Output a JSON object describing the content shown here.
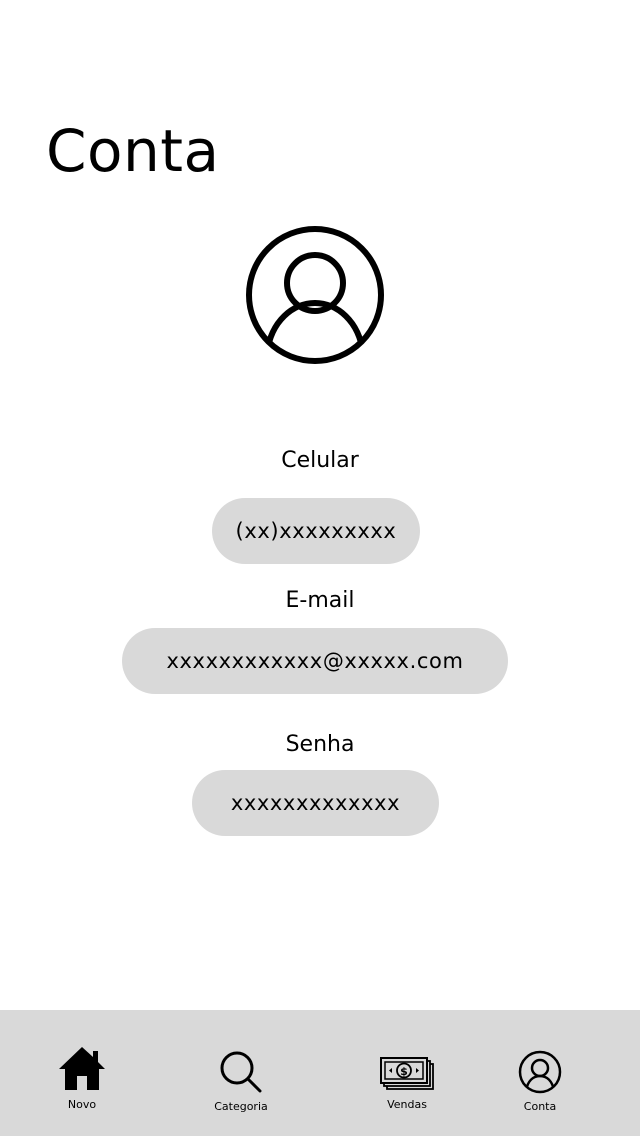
{
  "header": {
    "title": "Conta"
  },
  "profile": {
    "avatar_icon": "user-circle-icon"
  },
  "fields": {
    "phone": {
      "label": "Celular",
      "value": "(xx)xxxxxxxxx"
    },
    "email": {
      "label": "E-mail",
      "value": "xxxxxxxxxxxx@xxxxx.com"
    },
    "password": {
      "label": "Senha",
      "value": "xxxxxxxxxxxxx"
    }
  },
  "tabbar": {
    "background": "#d9d9d9",
    "items": [
      {
        "label": "Novo",
        "icon": "home-icon"
      },
      {
        "label": "Categoria",
        "icon": "search-icon"
      },
      {
        "label": "Vendas",
        "icon": "money-stack-icon"
      },
      {
        "label": "Conta",
        "icon": "user-circle-icon"
      }
    ]
  },
  "colors": {
    "field_background": "#d9d9d9",
    "text": "#000000",
    "background": "#ffffff"
  }
}
